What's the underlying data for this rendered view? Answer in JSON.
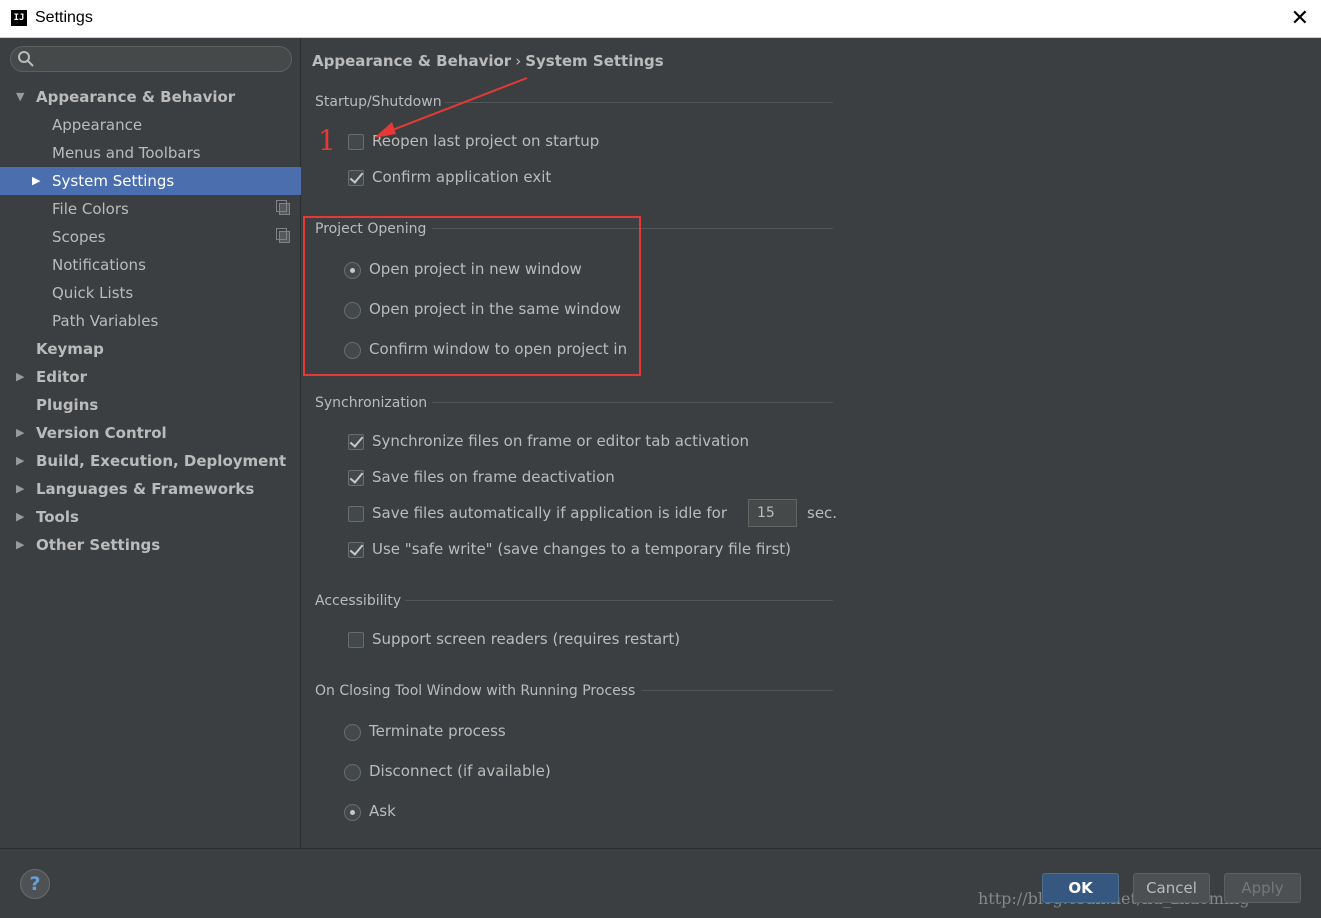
{
  "window": {
    "title": "Settings",
    "app_icon_text": "IJ",
    "close_glyph": "✕"
  },
  "sidebar": {
    "search_placeholder": "",
    "items": [
      {
        "label": "Appearance & Behavior",
        "level": 0,
        "bold": true,
        "expander": "▼"
      },
      {
        "label": "Appearance",
        "level": 1
      },
      {
        "label": "Menus and Toolbars",
        "level": 1
      },
      {
        "label": "System Settings",
        "level": 1,
        "selected": true,
        "expander": "▶"
      },
      {
        "label": "File Colors",
        "level": 1,
        "copy_icon": true
      },
      {
        "label": "Scopes",
        "level": 1,
        "copy_icon": true
      },
      {
        "label": "Notifications",
        "level": 1
      },
      {
        "label": "Quick Lists",
        "level": 1
      },
      {
        "label": "Path Variables",
        "level": 1
      },
      {
        "label": "Keymap",
        "level": 0,
        "bold": true
      },
      {
        "label": "Editor",
        "level": 0,
        "bold": true,
        "expander": "▶"
      },
      {
        "label": "Plugins",
        "level": 0,
        "bold": true
      },
      {
        "label": "Version Control",
        "level": 0,
        "bold": true,
        "expander": "▶"
      },
      {
        "label": "Build, Execution, Deployment",
        "level": 0,
        "bold": true,
        "expander": "▶"
      },
      {
        "label": "Languages & Frameworks",
        "level": 0,
        "bold": true,
        "expander": "▶"
      },
      {
        "label": "Tools",
        "level": 0,
        "bold": true,
        "expander": "▶"
      },
      {
        "label": "Other Settings",
        "level": 0,
        "bold": true,
        "expander": "▶"
      }
    ]
  },
  "breadcrumb": {
    "parent": "Appearance & Behavior",
    "separator": "›",
    "current": "System Settings"
  },
  "startup": {
    "title": "Startup/Shutdown",
    "reopen_label": "Reopen last project on startup",
    "reopen_checked": false,
    "confirm_exit_label": "Confirm application exit",
    "confirm_exit_checked": true
  },
  "project_opening": {
    "title": "Project Opening",
    "options": [
      "Open project in new window",
      "Open project in the same window",
      "Confirm window to open project in"
    ],
    "selected_index": 0
  },
  "sync": {
    "title": "Synchronization",
    "sync_files_label": "Synchronize files on frame or editor tab activation",
    "sync_files_checked": true,
    "save_deactivation_label": "Save files on frame deactivation",
    "save_deactivation_checked": true,
    "save_idle_label": "Save files automatically if application is idle for",
    "save_idle_checked": false,
    "idle_value": "15",
    "idle_unit": "sec.",
    "safe_write_label": "Use \"safe write\" (save changes to a temporary file first)",
    "safe_write_checked": true
  },
  "accessibility": {
    "title": "Accessibility",
    "screen_readers_label": "Support screen readers (requires restart)",
    "screen_readers_checked": false
  },
  "closing_tool_window": {
    "title": "On Closing Tool Window with Running Process",
    "options": [
      "Terminate process",
      "Disconnect (if available)",
      "Ask"
    ],
    "selected_index": 2
  },
  "annotation": {
    "number": "1",
    "color": "#e53935"
  },
  "footer": {
    "help_label": "?",
    "ok_label": "OK",
    "cancel_label": "Cancel",
    "apply_label": "Apply",
    "watermark": "http://blog.csdn.net/liu_zhaoming"
  },
  "colors": {
    "background": "#3c3f41",
    "selection": "#4b6eaf",
    "text": "#bbbbbb",
    "ok_button": "#365880"
  }
}
